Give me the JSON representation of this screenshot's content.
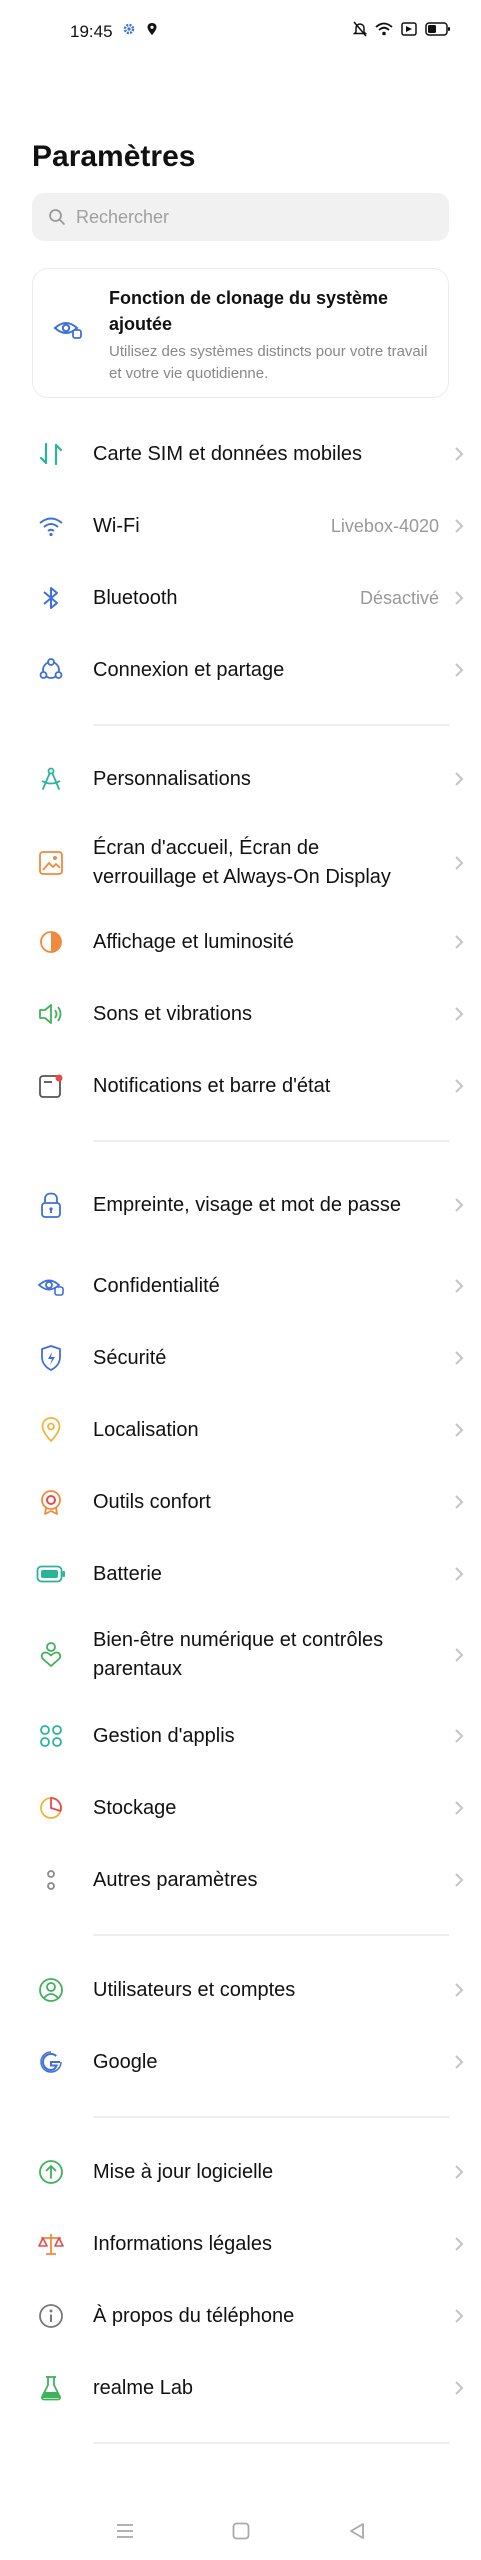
{
  "status_bar": {
    "time": "19:45"
  },
  "header": {
    "title": "Paramètres"
  },
  "search": {
    "placeholder": "Rechercher"
  },
  "clone_card": {
    "title": "Fonction de clonage du système ajoutée",
    "description": "Utilisez des systèmes distincts pour votre travail et votre vie quotidienne."
  },
  "items": [
    {
      "label": "Carte SIM et données mobiles",
      "value": "",
      "icon": "sim-data-icon"
    },
    {
      "label": "Wi-Fi",
      "value": "Livebox-4020",
      "icon": "wifi-icon"
    },
    {
      "label": "Bluetooth",
      "value": "Désactivé",
      "icon": "bluetooth-icon"
    },
    {
      "label": "Connexion et partage",
      "value": "",
      "icon": "share-icon"
    },
    {
      "label": "Personnalisations",
      "value": "",
      "icon": "compass-icon"
    },
    {
      "label": "Écran d'accueil, Écran de verrouillage et Always-On Display",
      "value": "",
      "icon": "wallpaper-icon"
    },
    {
      "label": "Affichage et luminosité",
      "value": "",
      "icon": "brightness-icon"
    },
    {
      "label": "Sons et vibrations",
      "value": "",
      "icon": "speaker-icon"
    },
    {
      "label": "Notifications et barre d'état",
      "value": "",
      "icon": "notification-icon"
    },
    {
      "label": "Empreinte, visage et mot de passe",
      "value": "",
      "icon": "lock-icon"
    },
    {
      "label": "Confidentialité",
      "value": "",
      "icon": "privacy-eye-icon"
    },
    {
      "label": "Sécurité",
      "value": "",
      "icon": "shield-icon"
    },
    {
      "label": "Localisation",
      "value": "",
      "icon": "location-icon"
    },
    {
      "label": "Outils confort",
      "value": "",
      "icon": "tools-icon"
    },
    {
      "label": "Batterie",
      "value": "",
      "icon": "battery-icon"
    },
    {
      "label": "Bien-être numérique et contrôles parentaux",
      "value": "",
      "icon": "wellbeing-icon"
    },
    {
      "label": "Gestion d'applis",
      "value": "",
      "icon": "apps-icon"
    },
    {
      "label": "Stockage",
      "value": "",
      "icon": "storage-icon"
    },
    {
      "label": "Autres paramètres",
      "value": "",
      "icon": "more-settings-icon"
    },
    {
      "label": "Utilisateurs et comptes",
      "value": "",
      "icon": "user-icon"
    },
    {
      "label": "Google",
      "value": "",
      "icon": "google-icon"
    },
    {
      "label": "Mise à jour logicielle",
      "value": "",
      "icon": "update-icon"
    },
    {
      "label": "Informations légales",
      "value": "",
      "icon": "legal-scale-icon"
    },
    {
      "label": "À propos du téléphone",
      "value": "",
      "icon": "info-icon"
    },
    {
      "label": "realme Lab",
      "value": "",
      "icon": "lab-flask-icon"
    }
  ],
  "colors": {
    "teal": "#2bb39a",
    "blue": "#3f6fd8",
    "orange": "#f08a3c",
    "green": "#3fb15a",
    "red": "#e84a4a",
    "yellow": "#f0b43a"
  }
}
